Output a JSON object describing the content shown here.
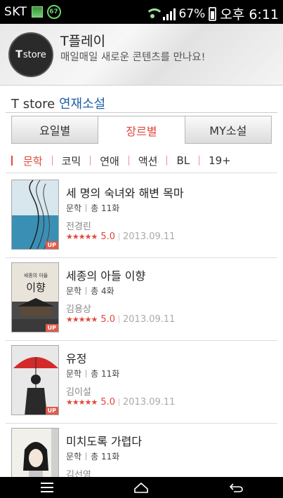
{
  "status_bar": {
    "carrier": "SKT",
    "badge_number": "67",
    "battery_percent": "67%",
    "time": "오후 6:11",
    "icons": [
      "notification-icon",
      "wifi-icon",
      "signal-icon",
      "battery-icon"
    ]
  },
  "header": {
    "logo_mark": "T",
    "logo_text": "store",
    "title": "T플레이",
    "subtitle": "매일매일 새로운 콘텐츠를 만나요!"
  },
  "section": {
    "brand": "T store",
    "name": "연재소설"
  },
  "tabs": [
    {
      "label": "요일별",
      "active": false
    },
    {
      "label": "장르별",
      "active": true
    },
    {
      "label": "MY소설",
      "active": false
    }
  ],
  "genres": [
    {
      "label": "문학",
      "active": true
    },
    {
      "label": "코믹",
      "active": false
    },
    {
      "label": "연애",
      "active": false
    },
    {
      "label": "액션",
      "active": false
    },
    {
      "label": "BL",
      "active": false
    },
    {
      "label": "19+",
      "active": false
    }
  ],
  "items": [
    {
      "title": "세 명의 숙녀와 해변 목마",
      "genre": "문학",
      "episodes": "총 11화",
      "author": "전경린",
      "stars": "★★★★★",
      "score": "5.0",
      "date": "2013.09.11",
      "badge": "UP"
    },
    {
      "title": "세종의 아들 이향",
      "genre": "문학",
      "episodes": "총 4화",
      "author": "김용상",
      "stars": "★★★★★",
      "score": "5.0",
      "date": "2013.09.11",
      "badge": "UP",
      "cover_text_top": "세종의 아들",
      "cover_text_main": "이향"
    },
    {
      "title": "유정",
      "genre": "문학",
      "episodes": "총 11화",
      "author": "김이설",
      "stars": "★★★★★",
      "score": "5.0",
      "date": "2013.09.11",
      "badge": "UP"
    },
    {
      "title": "미치도록 가렵다",
      "genre": "문학",
      "episodes": "총 11화",
      "author": "김선영",
      "stars": "",
      "score": "",
      "date": "",
      "badge": ""
    }
  ],
  "colors": {
    "accent": "#e0483b",
    "link": "#1d5fa7"
  }
}
